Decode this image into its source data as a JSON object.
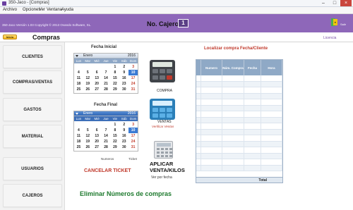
{
  "window": {
    "title": "350-Jaco - [Compras]",
    "min": "–",
    "max": "□",
    "close": "×"
  },
  "menu": [
    "Archivo",
    "Opciones",
    "Ver",
    "Ventana",
    "Ayuda"
  ],
  "header": {
    "info": "350-Jaco  Versión 1.03 Copyright © 2013 Ovando Software, SL.",
    "cajero_label": "No. Cajero",
    "cajero_number": "1",
    "exit_label": "Salir"
  },
  "subheader": {
    "inicio": "Inicio",
    "title": "Compras",
    "licencia": "Licencia"
  },
  "sidebar": [
    "CLIENTES",
    "COMPRAS/VENTAS",
    "GASTOS",
    "MATERIAL",
    "USUARIOS",
    "CAJEROS"
  ],
  "calendar_initial": {
    "heading": "Fecha Inicial",
    "month": "Enero",
    "year": "2016",
    "weekdays": [
      "Lun",
      "Mar",
      "Mié",
      "Jue",
      "Vie",
      "Sáb",
      "Dom"
    ],
    "rows": [
      [
        "",
        "",
        "",
        "",
        "1",
        "2",
        "3"
      ],
      [
        "4",
        "5",
        "6",
        "7",
        "8",
        "9",
        "10"
      ],
      [
        "11",
        "12",
        "13",
        "14",
        "15",
        "16",
        "17"
      ],
      [
        "18",
        "19",
        "20",
        "21",
        "22",
        "23",
        "24"
      ],
      [
        "25",
        "26",
        "27",
        "28",
        "29",
        "30",
        "31"
      ]
    ]
  },
  "calendar_final": {
    "heading": "Fecha Final",
    "month": "Enero",
    "year": "2016",
    "weekdays": [
      "Lun",
      "Mar",
      "Mié",
      "Jue",
      "Vie",
      "Sáb",
      "Dom"
    ],
    "rows": [
      [
        "",
        "",
        "",
        "",
        "1",
        "2",
        "3"
      ],
      [
        "4",
        "5",
        "6",
        "7",
        "8",
        "9",
        "10"
      ],
      [
        "11",
        "12",
        "13",
        "14",
        "15",
        "16",
        "17"
      ],
      [
        "18",
        "19",
        "20",
        "21",
        "22",
        "23",
        "24"
      ],
      [
        "25",
        "26",
        "27",
        "28",
        "29",
        "30",
        "31"
      ]
    ]
  },
  "labels": {
    "numeros": "Numeros",
    "ticket": "Ticket",
    "cancelar": "CANCELAR TICKET",
    "eliminar": "Eliminar Números de compras",
    "compra": "COMPRA",
    "ventas": "VENTAS",
    "verificar_ventas": "Verificar Ventas",
    "aplicar": "APLICAR VENTA/KILOS",
    "ver_por_fecha": "Ver por fecha",
    "localizar": "Localizar compra Fecha/Cliente"
  },
  "grid": {
    "columns": [
      "",
      "Numero",
      "Núm. Compra",
      "Fecha",
      "Hora"
    ],
    "total_label": "Total"
  },
  "colors": {
    "accent": "#8e67b9",
    "link_red": "#c0392b",
    "green": "#1e7a2e",
    "selected_day": "#3b7bd4"
  }
}
